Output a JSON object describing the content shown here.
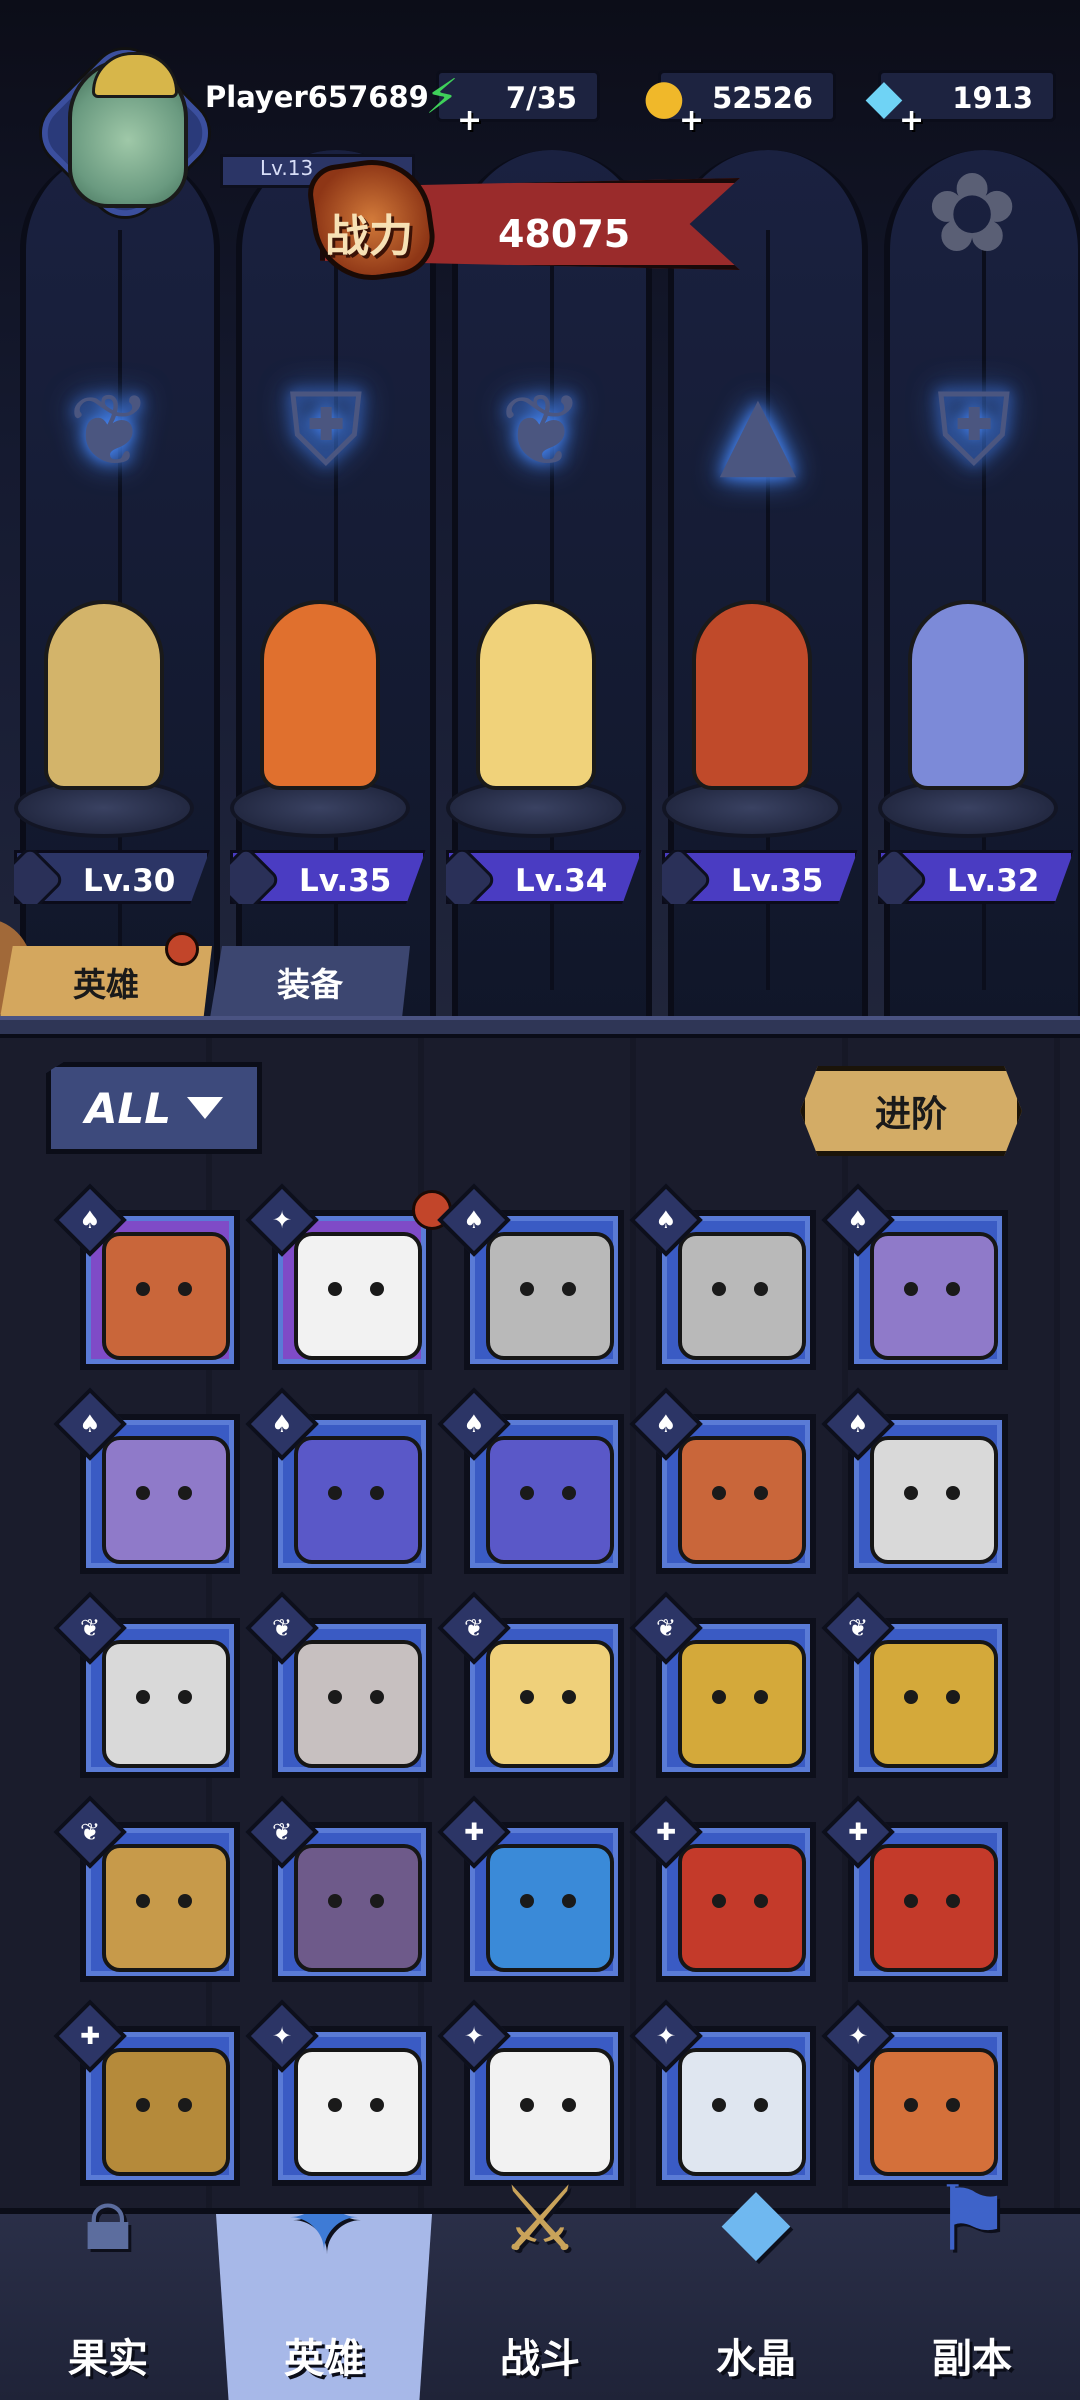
{
  "player": {
    "name": "Player657689",
    "level": "Lv.13"
  },
  "resources": [
    {
      "icon": "energy-icon",
      "value": "7/35"
    },
    {
      "icon": "gold-coin-icon",
      "value": "52526"
    },
    {
      "icon": "diamond-icon",
      "value": "1913"
    }
  ],
  "power": {
    "label": "战力",
    "value": "48075"
  },
  "class_emblems": [
    "wing-emblem-icon",
    "beast-claw-emblem-icon",
    "wing-emblem-icon",
    "mage-hat-emblem-icon",
    "beast-claw-emblem-icon"
  ],
  "lineup": [
    {
      "hero": "athena-warrior",
      "level": "Lv.30",
      "color": "#d3b46a"
    },
    {
      "hero": "fox-monk",
      "level": "Lv.35",
      "color": "#e0702e"
    },
    {
      "hero": "angel-archer",
      "level": "Lv.34",
      "color": "#f0d27a"
    },
    {
      "hero": "eye-mage",
      "level": "Lv.35",
      "color": "#c04a2a"
    },
    {
      "hero": "dragon-knight",
      "level": "Lv.32",
      "color": "#7c8ad8"
    }
  ],
  "tabs": {
    "heroes": "英雄",
    "equipment": "装备"
  },
  "filter": {
    "label": "ALL"
  },
  "advance_button": "进阶",
  "roster": [
    {
      "face": "#c9663a",
      "class": "♠",
      "frame": "#7f4bc7"
    },
    {
      "face": "#f2f2f2",
      "class": "✦",
      "frame": "#7f4bc7",
      "dot": true
    },
    {
      "face": "#b9b9b9",
      "class": "♠",
      "frame": "#3a5bc4"
    },
    {
      "face": "#b9b9b9",
      "class": "♠",
      "frame": "#3a5bc4"
    },
    {
      "face": "#8f7ac9",
      "class": "♠",
      "frame": "#3a5bc4"
    },
    {
      "face": "#8f7ac9",
      "class": "♠",
      "frame": "#3a5bc4"
    },
    {
      "face": "#5a58c8",
      "class": "♠",
      "frame": "#3a5bc4"
    },
    {
      "face": "#5a58c8",
      "class": "♠",
      "frame": "#3a5bc4"
    },
    {
      "face": "#c9663a",
      "class": "♠",
      "frame": "#3a5bc4"
    },
    {
      "face": "#d9d9d9",
      "class": "♠",
      "frame": "#3a5bc4"
    },
    {
      "face": "#d9d9d9",
      "class": "❦",
      "frame": "#3a5bc4"
    },
    {
      "face": "#c7c0c0",
      "class": "❦",
      "frame": "#3a5bc4"
    },
    {
      "face": "#efd07a",
      "class": "❦",
      "frame": "#3a5bc4"
    },
    {
      "face": "#d4a93a",
      "class": "❦",
      "frame": "#3a5bc4"
    },
    {
      "face": "#d4a93a",
      "class": "❦",
      "frame": "#3a5bc4"
    },
    {
      "face": "#c79a4a",
      "class": "❦",
      "frame": "#3a5bc4"
    },
    {
      "face": "#6e5a8a",
      "class": "❦",
      "frame": "#3a5bc4"
    },
    {
      "face": "#3a8ad8",
      "class": "✚",
      "frame": "#3a5bc4"
    },
    {
      "face": "#c43a2a",
      "class": "✚",
      "frame": "#3a5bc4"
    },
    {
      "face": "#c43a2a",
      "class": "✚",
      "frame": "#3a5bc4"
    },
    {
      "face": "#b58a3a",
      "class": "✚",
      "frame": "#3a5bc4"
    },
    {
      "face": "#f2f2f2",
      "class": "✦",
      "frame": "#3a5bc4"
    },
    {
      "face": "#f2f2f2",
      "class": "✦",
      "frame": "#3a5bc4"
    },
    {
      "face": "#dfe6f0",
      "class": "✦",
      "frame": "#3a5bc4"
    },
    {
      "face": "#d4703a",
      "class": "✦",
      "frame": "#3a5bc4"
    }
  ],
  "nav": [
    {
      "label": "果实",
      "icon": "padlock-icon"
    },
    {
      "label": "英雄",
      "icon": "hero-icon",
      "active": true
    },
    {
      "label": "战斗",
      "icon": "battle-icon"
    },
    {
      "label": "水晶",
      "icon": "crystal-icon"
    },
    {
      "label": "副本",
      "icon": "dungeon-flag-icon"
    }
  ]
}
